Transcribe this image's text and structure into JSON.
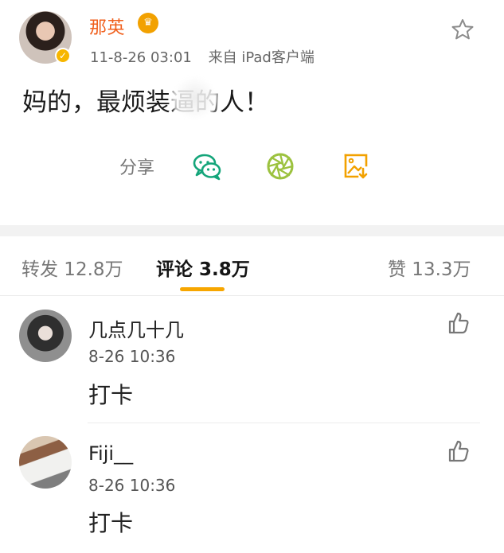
{
  "post": {
    "author": "那英",
    "timestamp": "11-8-26 03:01",
    "source": "来自 iPad客户端",
    "text": "妈的，最烦装逼的人！",
    "share_label": "分享",
    "icons": {
      "verified": "verified-badge-icon",
      "crown": "crown-icon",
      "favorite": "star-icon",
      "wechat": "wechat-icon",
      "moments": "moments-icon",
      "save_image": "save-image-icon"
    }
  },
  "tabs": {
    "repost": "转发 12.8万",
    "comments": "评论 3.8万",
    "likes": "赞 13.3万",
    "active": "comments"
  },
  "comments": [
    {
      "name": "几点几十几",
      "time": "8-26 10:36",
      "text": "打卡"
    },
    {
      "name": "Fiji__",
      "time": "8-26 10:36",
      "text": "打卡"
    }
  ],
  "colors": {
    "author": "#f05f1c",
    "tab_indicator": "#f7a600",
    "wechat": "#14a57a",
    "moments": "#9cc23f",
    "save_image": "#f2a100",
    "verified": "#f7b600",
    "separator": "#f2f2f2"
  }
}
